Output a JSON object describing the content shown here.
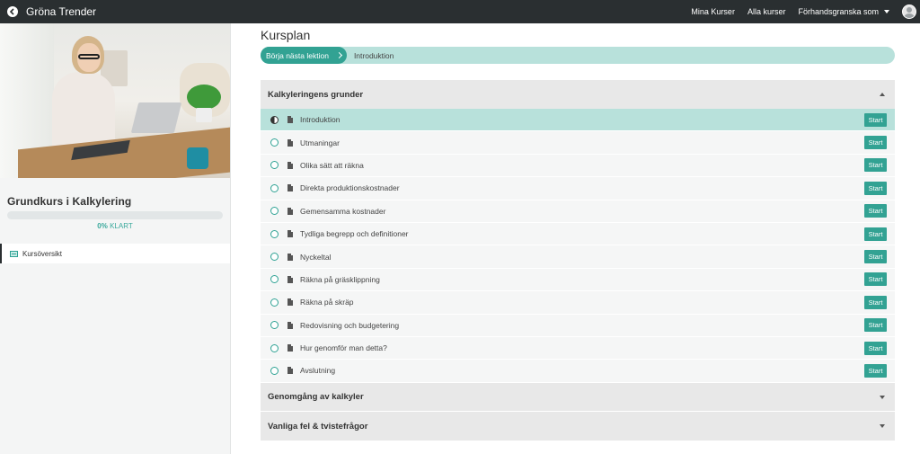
{
  "header": {
    "brand": "Gröna Trender",
    "nav": [
      "Mina Kurser",
      "Alla kurser"
    ],
    "preview_label": "Förhandsgranska som"
  },
  "sidebar": {
    "course_title": "Grundkurs i Kalkylering",
    "progress": {
      "percent_label": "0%",
      "suffix": "KLART",
      "value": 0
    },
    "nav_item_label": "Kursöversikt"
  },
  "main": {
    "title": "Kursplan",
    "resume": {
      "button_label": "Börja nästa lektion",
      "current_lesson": "Introduktion"
    },
    "sections": [
      {
        "title": "Kalkyleringens grunder",
        "expanded": true,
        "lessons": [
          "Introduktion",
          "Utmaningar",
          "Olika sätt att räkna",
          "Direkta produktionskostnader",
          "Gemensamma kostnader",
          "Tydliga begrepp och definitioner",
          "Nyckeltal",
          "Räkna på gräsklippning",
          "Räkna på skräp",
          "Redovisning och budgetering",
          "Hur genomför man detta?",
          "Avslutning"
        ]
      },
      {
        "title": "Genomgång av kalkyler",
        "expanded": false
      },
      {
        "title": "Vanliga fel & tvistefrågor",
        "expanded": false
      }
    ],
    "start_label": "Start"
  },
  "colors": {
    "topbar": "#2a2f31",
    "accent": "#32a293",
    "accent_light": "#b8e1db",
    "section_bg": "#e8e8e8"
  }
}
